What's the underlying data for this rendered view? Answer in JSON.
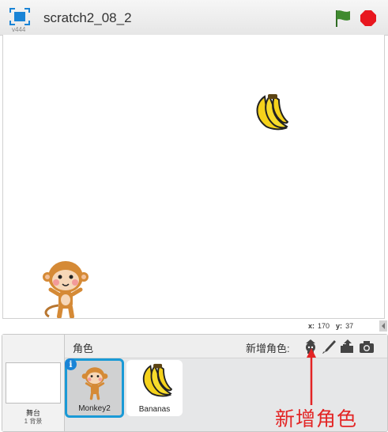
{
  "header": {
    "version": "v444",
    "project_title": "scratch2_08_2"
  },
  "stage": {
    "mouse_x_label": "x:",
    "mouse_x": "170",
    "mouse_y_label": "y:",
    "mouse_y": "37"
  },
  "sprites_panel": {
    "heading": "角色",
    "new_sprite_label": "新增角色:",
    "stage_label": "舞台",
    "backdrop_count": "1 背景",
    "sprites": [
      {
        "name": "Monkey2",
        "selected": true
      },
      {
        "name": "Bananas",
        "selected": false
      }
    ]
  },
  "annotation": {
    "text": "新增角色",
    "color": "#e32424"
  },
  "colors": {
    "accent": "#1a9ad6",
    "flag": "#3f8a2f",
    "stop": "#e8171f"
  }
}
